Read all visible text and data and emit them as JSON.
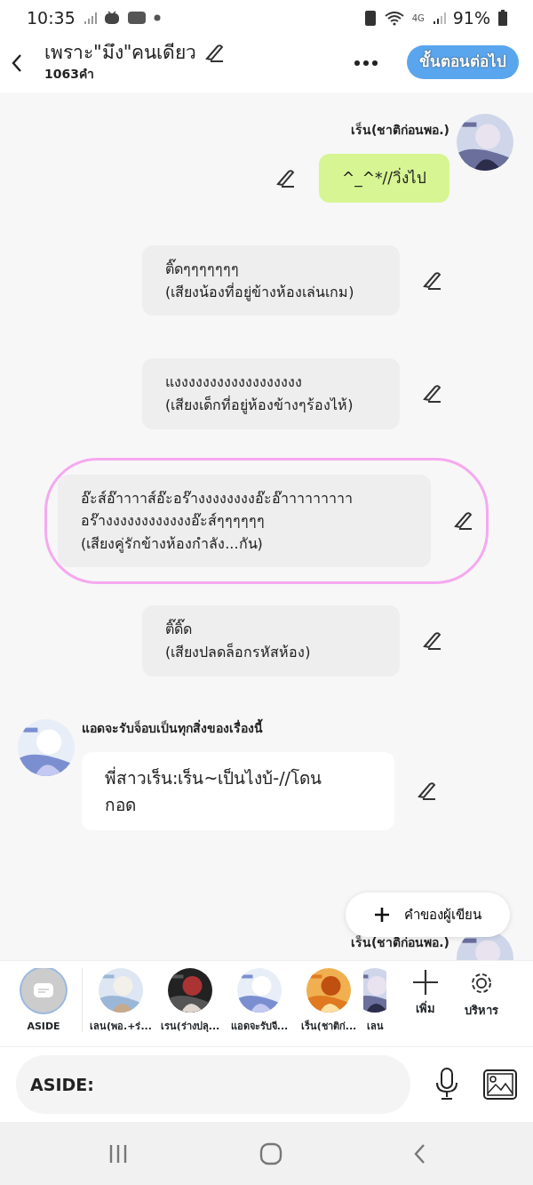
{
  "status_bar": {
    "time": "10:35",
    "network": "4G",
    "battery": "91%"
  },
  "header": {
    "title": "เพราะ\"มึง\"คนเดียว",
    "word_count": "1063คำ",
    "next_button": "ขั้นตอนต่อไป"
  },
  "messages": [
    {
      "kind": "right",
      "name": "เร็น(ชาติก่อนพอ.)",
      "text": "^_^*//วิ่งไป"
    },
    {
      "kind": "narration",
      "text": "ติ๊ดๆๆๆๆๆๆๆ\n(เสียงน้องที่อยู่ข้างห้องเล่นเกม)",
      "highlighted": false
    },
    {
      "kind": "narration",
      "text": "แงงงงงงงงงงงงงงงงงง\n(เสียงเด็กที่อยู่ห้องข้างๆร้องไห้)",
      "highlighted": false
    },
    {
      "kind": "narration",
      "text": "อ๊ะส์อ๊าาาาส์อ๊ะอร๊างงงงงงงงอ๊ะอ๊าาาาาาาาา\nอร๊างงงงงงงงงงงงอ๊ะส์ๆๆๆๆๆๆ\n(เสียงคู่รักข้างห้องกำลัง...กัน)",
      "highlighted": true
    },
    {
      "kind": "narration",
      "text": "ติ๊ดิ๊ด\n(เสียงปลดล็อกรหัสห้อง)",
      "highlighted": false
    },
    {
      "kind": "left",
      "name": "แอดจะรับจ็อบเป็นทุกสิ่งของเรื่องนี้",
      "text": "พี่สาวเร็น:เร็น~เป็นไงบ้-//โดน\nกอด"
    },
    {
      "kind": "right_partial",
      "name": "เร็น(ชาติก่อนพอ.)"
    }
  ],
  "author_note_button": "คำของผู้เขียน",
  "characters": [
    {
      "kind": "aside",
      "label": "ASIDE",
      "selected": true
    },
    {
      "kind": "avatar",
      "label": "เลน(พอ.+ร่...",
      "selected": false
    },
    {
      "kind": "avatar",
      "label": "เรน(ร่างปลุ...",
      "selected": false
    },
    {
      "kind": "avatar",
      "label": "แอดจะรับจี...",
      "selected": false
    },
    {
      "kind": "avatar",
      "label": "เร็น(ชาติก่...",
      "selected": false
    },
    {
      "kind": "avatar",
      "label": "เลน",
      "selected": false
    }
  ],
  "add_button": "เพิ่ม",
  "manage_button": "บริหาร",
  "input": {
    "placeholder": "ASIDE:"
  }
}
